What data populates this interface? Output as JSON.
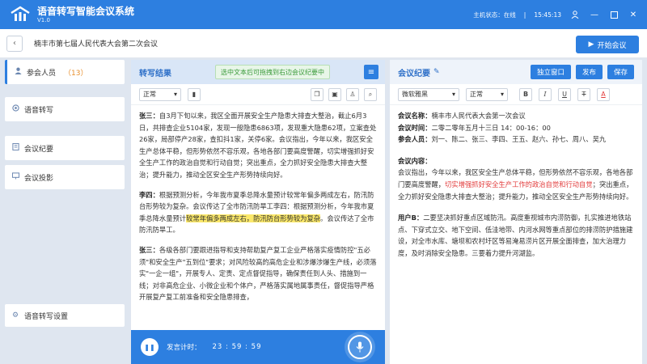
{
  "app": {
    "name": "语音转写智能会议系统",
    "version": "V1.0",
    "host_status": "主机状态：在线",
    "time": "15:45:13"
  },
  "nav": {
    "meeting_name": "楠丰市第七届人民代表大会第二次会议",
    "start_button": "开始会议"
  },
  "sidebar": {
    "items": [
      {
        "label": "参会人员",
        "count": "（13）",
        "icon": "user-icon"
      },
      {
        "label": "语音转写",
        "icon": "mic-icon"
      },
      {
        "label": "会议纪要",
        "icon": "document-icon"
      },
      {
        "label": "会议投影",
        "icon": "projector-icon"
      }
    ],
    "settings_label": "语音转写设置"
  },
  "transcript": {
    "title": "转写结果",
    "hint": "选中文本后可拖拽到右边会议纪要中",
    "style_select": "正常",
    "paragraphs": [
      {
        "speaker": "张三：",
        "text_before": "自3月下旬以来，我区全面开展安全生产隐患大排查大整治，截止6月3日，共排查企业5104家，发现一般隐患6863项，发现重大隐患62项，立案查处26家，局部停产28家，查扣抖1家，关停6家。会议指出，今年以来，我区安全生产总体平稳，但形势依然不容乐观，各地各部门要高度警醒，切实增强抓好安全生产工作的政治自觉和行动自觉；突出重点，全力抓好安全隐患大排查大整治；提升能力，推动全区安全生产形势持续向好。",
        "highlight": "",
        "text_after": ""
      },
      {
        "speaker": "李四：",
        "text_before": "根据预测分析，今年我市夏季总降水量预计较常年偏多两成左右，防汛防台形势较为复杂。会议传达了全市防汛防旱工李四：根据预测分析，今年我市夏季总降水量预计",
        "highlight": "较常年偏多两成左右，防汛防台形势较为复杂",
        "text_after": "。会议传达了全市防汛防旱工。"
      },
      {
        "speaker": "张三：",
        "text_before": "各级各部门要跟进指导和支持帮助复产复工企业严格落实疫情防控\"五必须\"和安全生产\"五到位\"要求；对风险较高的高危企业和涉爆涉爆生产线，必须落实\"一企一组\"，开展专人、定责、定点督促指导，确保责任到人头、措施到一线；对非高危企业、小微企业和个体户，严格落实属地属事责任，督促指导严格开展复产复工前准备和安全隐患排查，",
        "highlight": "",
        "text_after": ""
      }
    ],
    "timer_label": "发言计时：",
    "timer_value": "23 : 59 : 59"
  },
  "minutes": {
    "title": "会议纪要",
    "buttons": [
      "独立窗口",
      "发布",
      "保存"
    ],
    "font_select": "微软雅黑",
    "style_select": "正常",
    "meeting_name_label": "会议名称：",
    "meeting_name": "楠丰市人民代表大会第一次会议",
    "meeting_time_label": "会议时间：",
    "meeting_time": "二零二零年五月十三日 14：00-16：00",
    "attendees_label": "参会人员：",
    "attendees": "刘一、陈二、张三、李四、王五、赵六、孙七、周八、吴九",
    "content_label": "会议内容：",
    "content_before": "会议指出，今年以来，我区安全生产总体平稳，但形势依然不容乐观，各地各部门要高度警醒，",
    "content_red": "切实增强抓好安全生产工作的政治自觉和行动自觉",
    "content_after": "；突出重点，全力抓好安全隐患大排查大整治；提升能力，推动全区安全生产形势持续向好。",
    "userb_label": "用户B：",
    "userb_text": "二要坚决抓好重点区域防汛。高度重视城市内涝防御，扎实推进地铁站点、下穿式立交、地下空间、低洼地带、内河水网等重点部位的排涝防护措施建设，对全市水库、塘坝和农村圩区等易淹易涝片区开展全面排查，加大治理力度，及时消除安全隐患。三要着力提升河湖监。"
  },
  "colors": {
    "primary": "#2d7fe0",
    "highlight": "#fbe86a",
    "red_text": "#e23b3b",
    "count": "#e8902e"
  }
}
